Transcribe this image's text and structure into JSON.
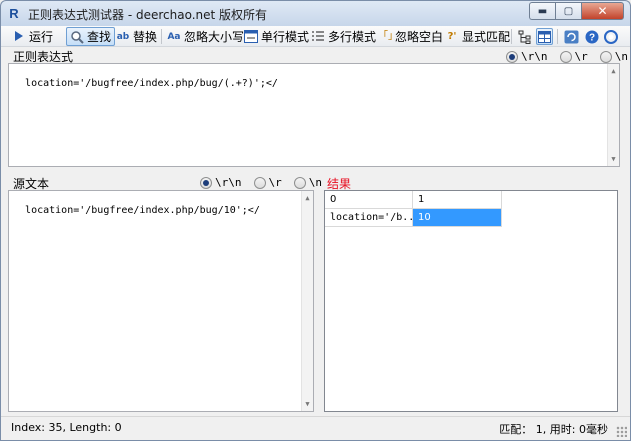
{
  "window": {
    "app_icon": "R",
    "title": "正则表达式测试器 - deerchao.net 版权所有",
    "minimize_glyph": "▬",
    "maximize_glyph": "▢",
    "close_glyph": "✕"
  },
  "toolbar": {
    "run_label": "运行",
    "find_label": "查找",
    "replace_label": "替换",
    "ignore_case_label": "忽略大小写",
    "single_line_label": "单行模式",
    "multi_line_label": "多行模式",
    "ignore_whitespace_label": "忽略空白",
    "explicit_capture_label": "显式匹配"
  },
  "regex_section": {
    "label": "正则表达式",
    "value": "location='/bugfree/index.php/bug/(.+?)';</",
    "newline_options": [
      "\\r\\n",
      "\\r",
      "\\n"
    ],
    "selected_option": "\\r\\n"
  },
  "source_section": {
    "label": "源文本",
    "value": "location='/bugfree/index.php/bug/10';</",
    "newline_options": [
      "\\r\\n",
      "\\r",
      "\\n"
    ],
    "selected_option": "\\r\\n"
  },
  "results": {
    "label": "结果",
    "label_color": "#e81123",
    "columns": [
      "0",
      "1"
    ],
    "rows": [
      [
        "location='/b...",
        "10"
      ]
    ],
    "selection_color": "#3399ff"
  },
  "status": {
    "left": "Index: 35, Length: 0",
    "right": "匹配： 1, 用时: 0毫秒"
  }
}
